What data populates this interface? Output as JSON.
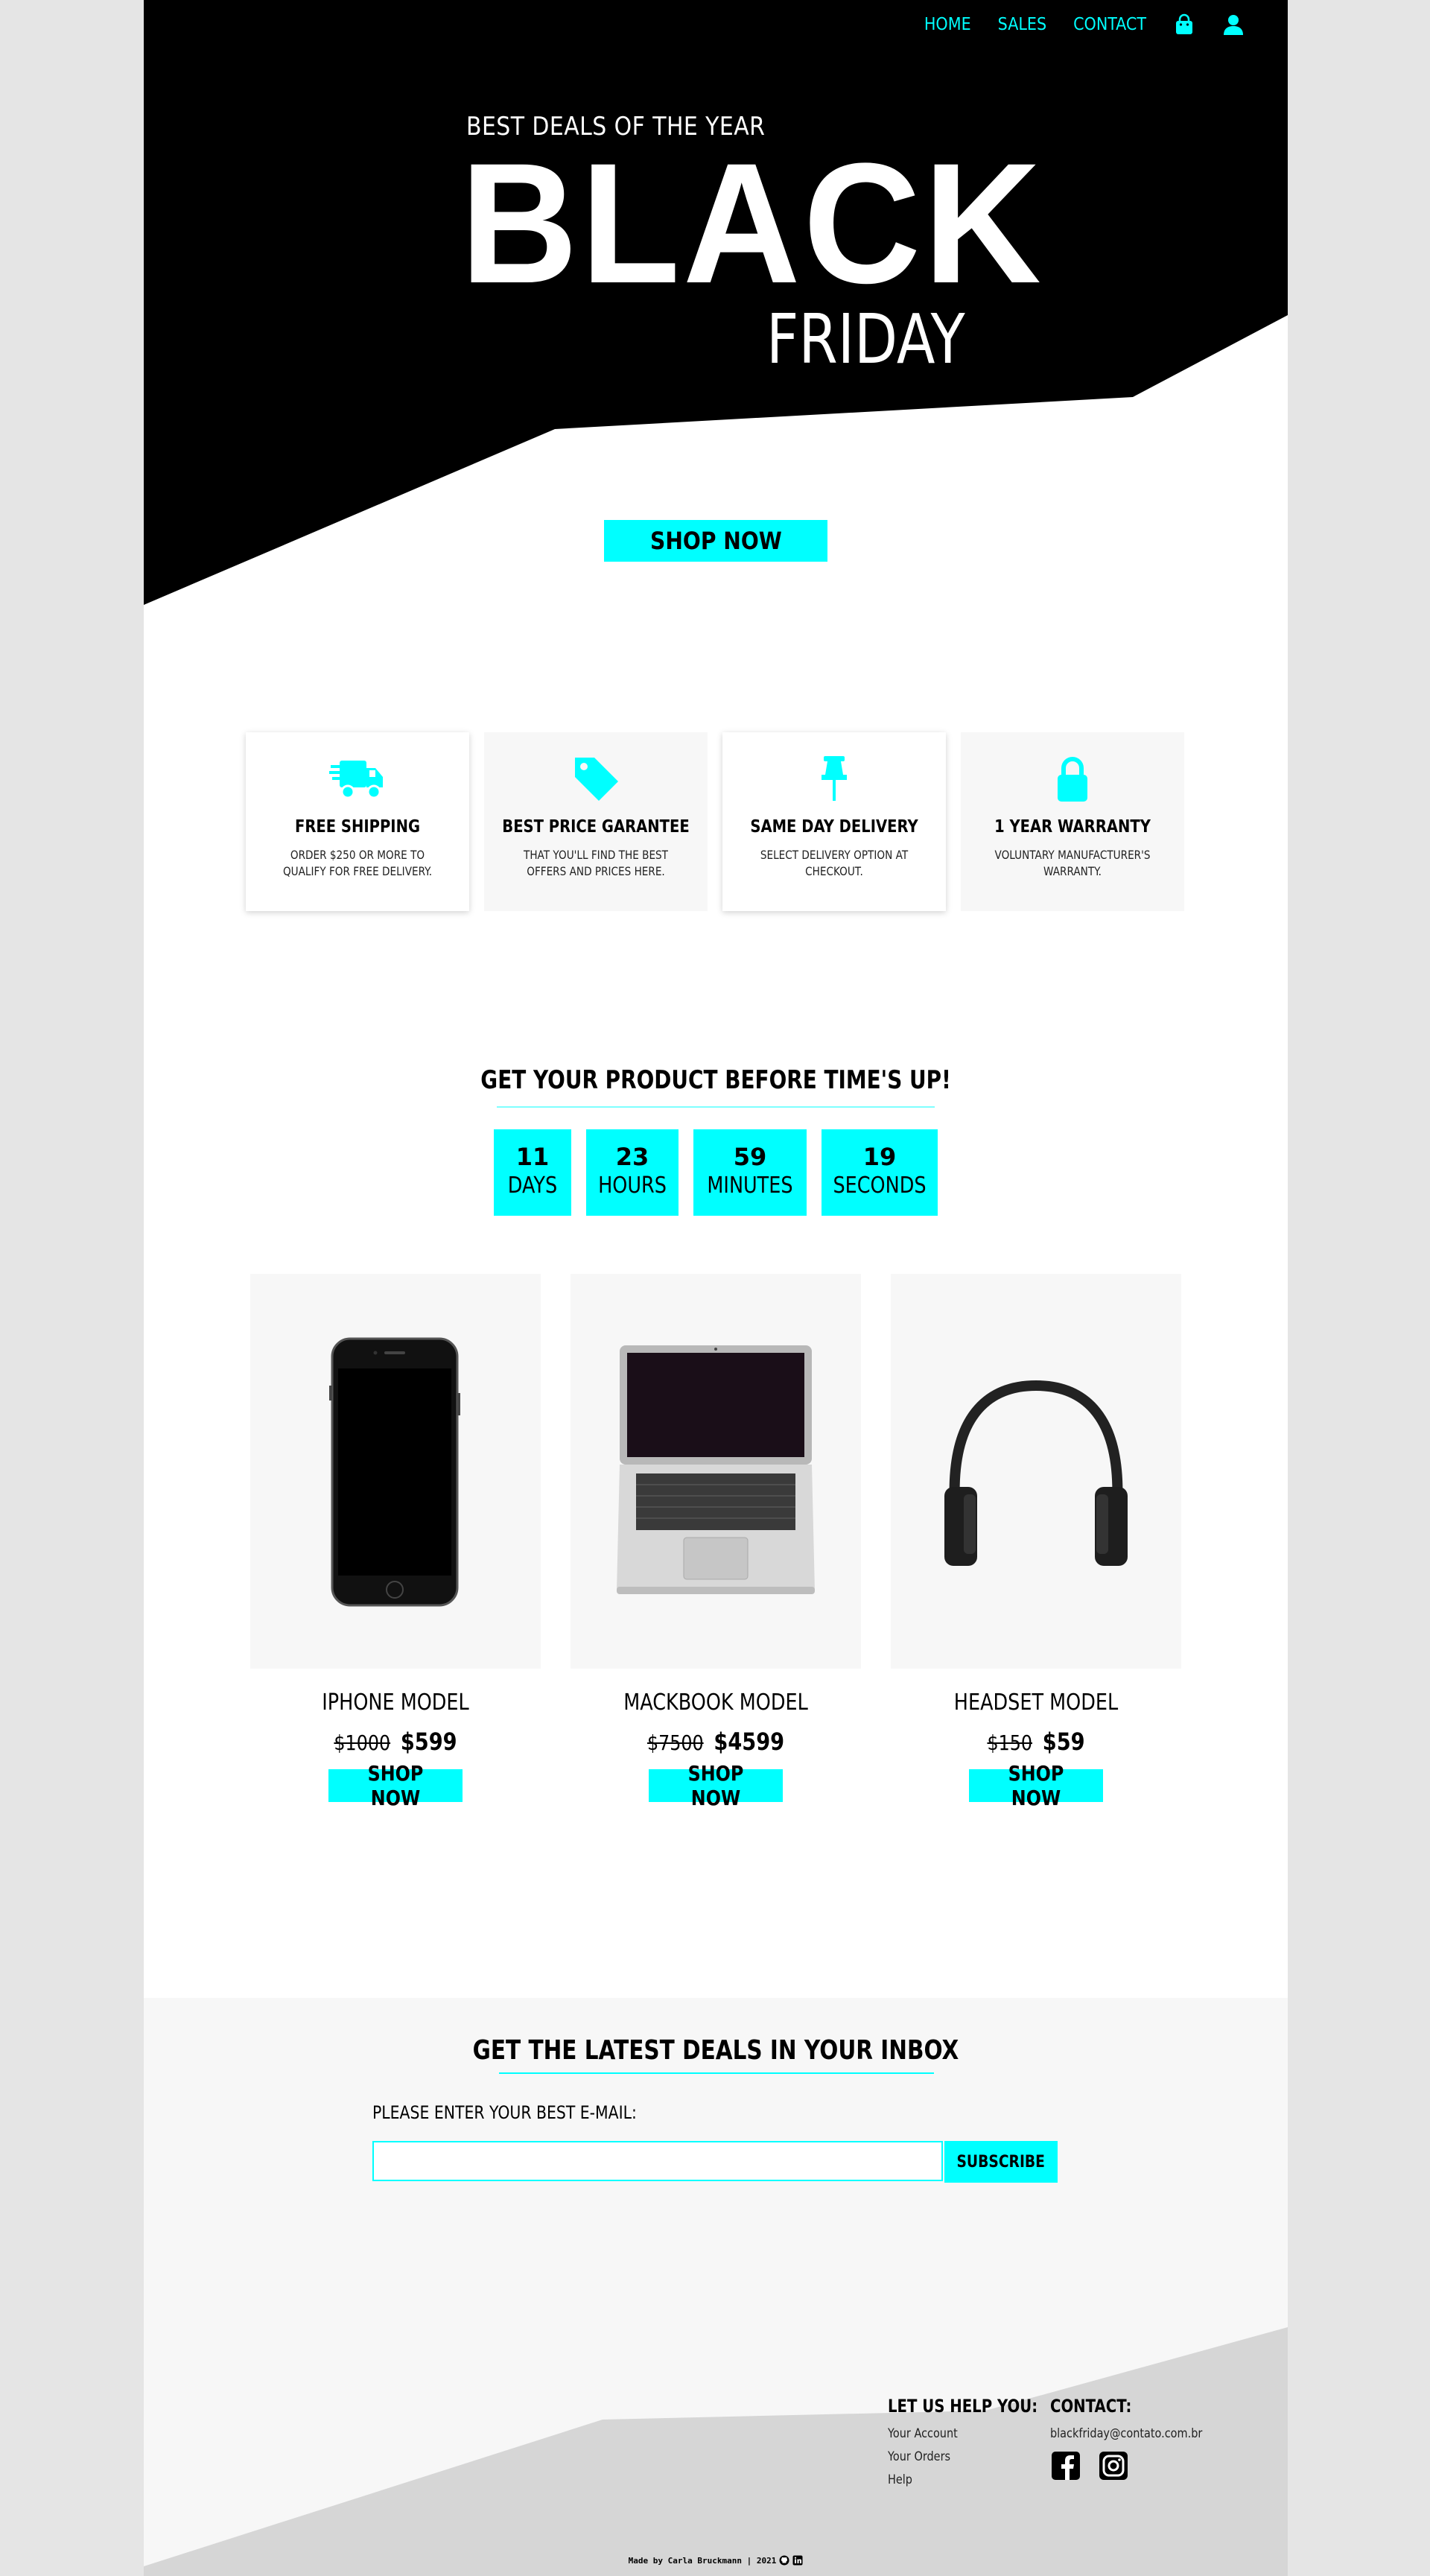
{
  "nav": {
    "items": [
      "HOME",
      "SALES",
      "CONTACT"
    ],
    "cart_icon": "shopping-bag-icon",
    "user_icon": "user-icon"
  },
  "hero": {
    "subtitle": "BEST DEALS OF THE YEAR",
    "title": "BLACK",
    "title2": "FRIDAY",
    "button": "SHOP NOW"
  },
  "features": [
    {
      "icon": "shipping-truck-icon",
      "title": "FREE SHIPPING",
      "text": "ORDER $250 OR MORE TO QUALIFY FOR FREE DELIVERY."
    },
    {
      "icon": "price-tag-icon",
      "title": "BEST PRICE GARANTEE",
      "text": "THAT YOU'LL FIND THE BEST OFFERS AND PRICES HERE."
    },
    {
      "icon": "push-pin-icon",
      "title": "SAME DAY DELIVERY",
      "text": "SELECT DELIVERY OPTION AT CHECKOUT."
    },
    {
      "icon": "lock-icon",
      "title": "1 YEAR WARRANTY",
      "text": "VOLUNTARY MANUFACTURER'S WARRANTY."
    }
  ],
  "countdown": {
    "title": "GET YOUR PRODUCT BEFORE TIME'S UP!",
    "units": [
      {
        "value": "11",
        "label": "DAYS"
      },
      {
        "value": "23",
        "label": "HOURS"
      },
      {
        "value": "59",
        "label": "MINUTES"
      },
      {
        "value": "19",
        "label": "SECONDS"
      }
    ]
  },
  "products": [
    {
      "name": "IPHONE MODEL",
      "old_price": "$1000",
      "price": "$599",
      "button": "SHOP NOW",
      "image": "iphone"
    },
    {
      "name": "MACKBOOK MODEL",
      "old_price": "$7500",
      "price": "$4599",
      "button": "SHOP NOW",
      "image": "macbook"
    },
    {
      "name": "HEADSET MODEL",
      "old_price": "$150",
      "price": "$59",
      "button": "SHOP NOW",
      "image": "headset"
    }
  ],
  "newsletter": {
    "title": "GET THE LATEST DEALS IN YOUR INBOX",
    "label": "PLEASE ENTER YOUR BEST E-MAIL:",
    "input_value": "",
    "button": "SUBSCRIBE"
  },
  "footer": {
    "help_title": "LET US HELP YOU:",
    "help_links": [
      "Your Account",
      "Your Orders",
      "Help"
    ],
    "contact_title": "CONTACT:",
    "email": "blackfriday@contato.com.br",
    "social_icons": [
      "facebook-icon",
      "instagram-icon"
    ],
    "credit": "Made by Carla Bruckmann | 2021",
    "credit_icons": [
      "github-icon",
      "linkedin-icon"
    ]
  },
  "colors": {
    "accent": "#00ffff",
    "hero_bg": "#000000",
    "panel_bg": "#f7f7f7",
    "page_outer": "#e5e5e5",
    "footer_shape": "#d6d6d6"
  }
}
